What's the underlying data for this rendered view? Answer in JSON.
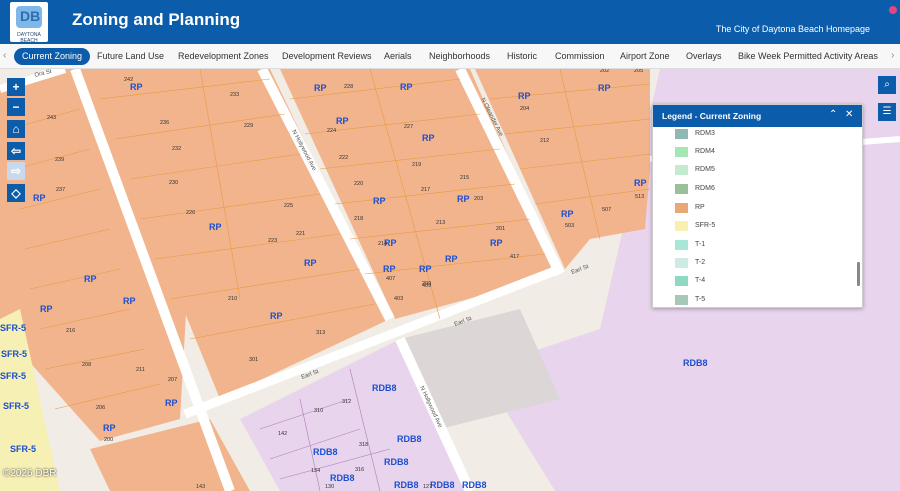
{
  "header": {
    "logo_text": "DB",
    "logo_sub": "DAYTONA BEACH",
    "title": "Zoning and Planning",
    "home_link": "The City of Daytona Beach Homepage"
  },
  "tabs": [
    "Current Zoning",
    "Future Land Use",
    "Redevelopment Zones",
    "Development Reviews",
    "Aerials",
    "Neighborhoods",
    "Historic",
    "Commission",
    "Airport Zone",
    "Overlays",
    "Bike Week Permitted Activity Areas"
  ],
  "map": {
    "zone_labels": [
      "RP",
      "RP",
      "RP",
      "RP",
      "RP",
      "RP",
      "RP",
      "RP",
      "RP",
      "RP",
      "RP",
      "RP",
      "RP",
      "RP",
      "RP",
      "RP",
      "RP",
      "RP",
      "RP",
      "RP",
      "RP",
      "RP",
      "RP",
      "RP",
      "RP",
      "RDB8",
      "RDB8",
      "RDB8",
      "RDB8",
      "RDB8",
      "RDB8",
      "RDB8",
      "RDB8",
      "RDB8",
      "SFR-5",
      "SFR-5",
      "SFR-5",
      "SFR-5",
      "SFR-5"
    ],
    "streets": [
      "Ora St",
      "N Hollywood Ave",
      "N Oleander Ave",
      "Earl St",
      "Earl St",
      "Earl St",
      "N Hollywood Ave"
    ],
    "lot_numbers": [
      "242",
      "243",
      "239",
      "237",
      "233",
      "236",
      "232",
      "230",
      "229",
      "226",
      "224",
      "225",
      "222",
      "223",
      "221",
      "220",
      "219",
      "218",
      "217",
      "216",
      "215",
      "214",
      "213",
      "212",
      "211",
      "210",
      "209",
      "208",
      "207",
      "206",
      "205",
      "204",
      "203",
      "202",
      "201",
      "228",
      "227",
      "407",
      "409",
      "403",
      "417",
      "503",
      "507",
      "513",
      "301",
      "313",
      "310",
      "312",
      "318",
      "316",
      "142",
      "134",
      "130",
      "127",
      "143",
      "200"
    ],
    "credit": "©2026 DBR"
  },
  "legend": {
    "title": "Legend - Current Zoning",
    "items": [
      {
        "label": "RDM3",
        "color": "#8fb8b4"
      },
      {
        "label": "RDM4",
        "color": "#a6e6b4"
      },
      {
        "label": "RDM5",
        "color": "#c4ead0"
      },
      {
        "label": "RDM6",
        "color": "#9ac09a"
      },
      {
        "label": "RP",
        "color": "#e8a878"
      },
      {
        "label": "SFR-5",
        "color": "#f7f0b0"
      },
      {
        "label": "T-1",
        "color": "#a8e6d8"
      },
      {
        "label": "T-2",
        "color": "#cdeae4"
      },
      {
        "label": "T-4",
        "color": "#8ed8c4"
      },
      {
        "label": "T-5",
        "color": "#a6c8b8"
      }
    ]
  }
}
